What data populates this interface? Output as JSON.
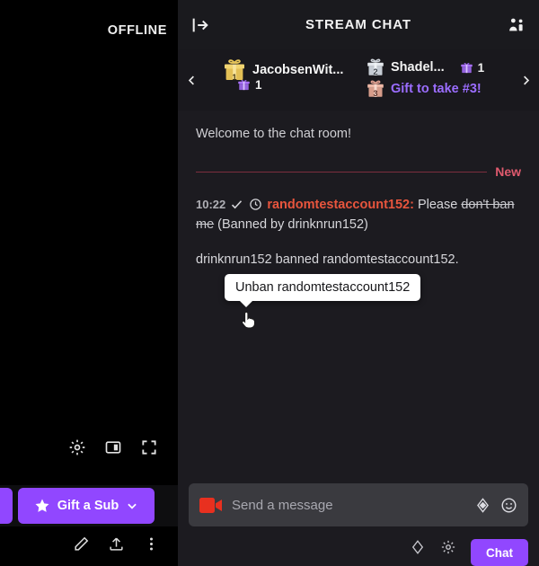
{
  "video": {
    "offline_label": "OFFLINE",
    "controls": [
      {
        "name": "settings-icon",
        "icon": "gear-icon"
      },
      {
        "name": "theater-mode-icon",
        "icon": "theater-icon"
      },
      {
        "name": "fullscreen-icon",
        "icon": "fullscreen-icon"
      }
    ],
    "gift_sub_label": "Gift a Sub",
    "bottom_tools": [
      {
        "name": "edit-icon",
        "icon": "pencil-icon"
      },
      {
        "name": "share-icon",
        "icon": "upload-icon"
      },
      {
        "name": "more-options-icon",
        "icon": "kebab-icon"
      }
    ]
  },
  "chat": {
    "header": {
      "collapse_label": "collapse-chat-icon",
      "title": "STREAM CHAT",
      "community_label": "community-icon"
    },
    "carousel": {
      "prev_label": "‹",
      "next_label": "›",
      "gifts": [
        {
          "rank": "1",
          "name": "JacobsenWit...",
          "count": "",
          "tier": "gold"
        },
        {
          "rank": "",
          "name": "",
          "count": "1",
          "tier": "count-only"
        },
        {
          "rank": "2",
          "name": "Shadel...",
          "count": "1",
          "tier": "silver"
        },
        {
          "rank": "3",
          "name": "Gift to take #3!",
          "count": "",
          "tier": "bronze"
        }
      ]
    },
    "welcome_message": "Welcome to the chat room!",
    "divider_label": "New",
    "tooltip_text": "Unban randomtestaccount152",
    "messages": [
      {
        "timestamp": "10:22",
        "username": "randomtestaccount152",
        "separator": ":",
        "text_before": " Please ",
        "struck_text": "don't ban me",
        "text_after": "  (Banned by drinknrun152)"
      },
      {
        "system_text": "drinknrun152 banned randomtestaccount152."
      }
    ],
    "input": {
      "placeholder": "Send a message",
      "value": "",
      "video_icon": "video-camera-icon",
      "bits_icon": "bits-diamond-icon",
      "emote_icon": "emote-smiley-icon"
    },
    "footer": {
      "send_label": "Chat",
      "icons": [
        {
          "name": "bits-icon"
        },
        {
          "name": "settings-gear-icon"
        }
      ]
    }
  },
  "colors": {
    "brand_purple": "#9147ff",
    "username_red": "#e8553d",
    "new_red": "#e05a6e",
    "promo_purple": "#9b6dff",
    "video_red": "#e8301f"
  }
}
